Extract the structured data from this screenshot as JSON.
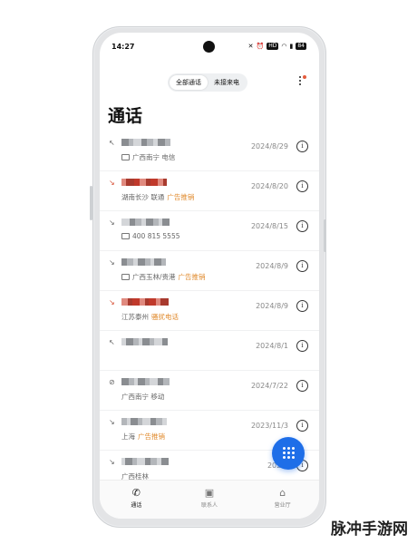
{
  "status_bar": {
    "time": "14:27",
    "battery": "84",
    "icons": [
      "mute-icon",
      "alarm-icon",
      "hd-icon",
      "wifi-icon",
      "signal-icon",
      "battery-icon"
    ]
  },
  "segment": {
    "tabs": [
      {
        "label": "全部通话",
        "active": true
      },
      {
        "label": "未接来电",
        "active": false
      }
    ]
  },
  "menu": {
    "icon": "more-vertical-icon",
    "has_notification_dot": true
  },
  "page_title": "通话",
  "calls": [
    {
      "direction": "outgoing",
      "missed": false,
      "location": "广西南宁 电信",
      "tag": "",
      "date": "2024/8/29",
      "sim": true
    },
    {
      "direction": "incoming",
      "missed": true,
      "location": "湖南长沙 联通",
      "tag": "广告推销",
      "date": "2024/8/20",
      "sim": false
    },
    {
      "direction": "incoming",
      "missed": false,
      "location": "400 815 5555",
      "tag": "",
      "date": "2024/8/15",
      "sim": true
    },
    {
      "direction": "incoming",
      "missed": false,
      "location": "广西玉林/贵港",
      "tag": "广告推销",
      "date": "2024/8/9",
      "sim": true
    },
    {
      "direction": "incoming",
      "missed": true,
      "location": "江苏泰州",
      "tag": "骚扰电话",
      "date": "2024/8/9",
      "sim": false
    },
    {
      "direction": "outgoing",
      "missed": false,
      "location": "",
      "tag": "",
      "date": "2024/8/1",
      "sim": false
    },
    {
      "direction": "blocked",
      "missed": false,
      "location": "广西南宁 移动",
      "tag": "",
      "date": "2024/7/22",
      "sim": false
    },
    {
      "direction": "incoming",
      "missed": false,
      "location": "上海",
      "tag": "广告推销",
      "date": "2023/11/3",
      "sim": false
    },
    {
      "direction": "incoming",
      "missed": false,
      "location": "广西桂林",
      "tag": "",
      "date": "2023/",
      "sim": false
    }
  ],
  "fab": {
    "icon": "dialpad-icon"
  },
  "tabbar": [
    {
      "label": "通话",
      "icon": "phone-icon",
      "active": true
    },
    {
      "label": "联系人",
      "icon": "contacts-icon",
      "active": false
    },
    {
      "label": "营业厅",
      "icon": "store-icon",
      "active": false
    }
  ],
  "watermark": "脉冲手游网"
}
